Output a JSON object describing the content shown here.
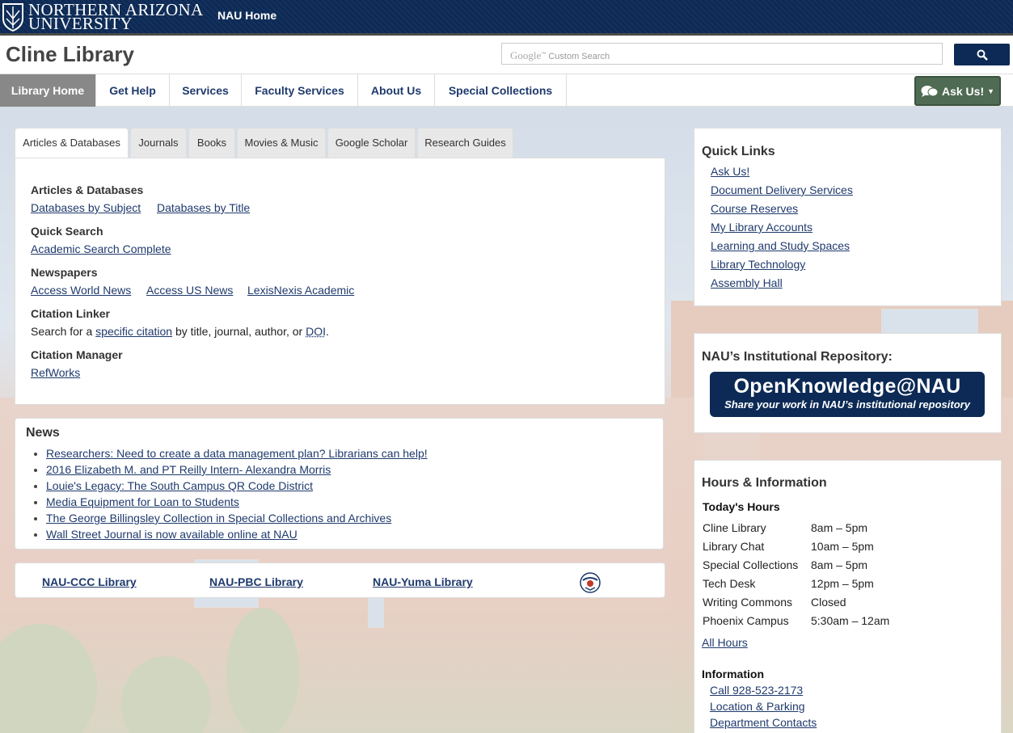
{
  "topbar": {
    "logo_line1": "NORTHERN ARIZONA",
    "logo_line2": "UNIVERSITY",
    "home_link": "NAU Home"
  },
  "header": {
    "site_title": "Cline Library",
    "search_brand": "Google",
    "search_placeholder": "Custom Search",
    "search_icon": "search-icon"
  },
  "nav": {
    "items": [
      "Library Home",
      "Get Help",
      "Services",
      "Faculty Services",
      "About Us",
      "Special Collections"
    ],
    "active": "Library Home",
    "ask_label": "Ask Us!"
  },
  "tabs": [
    "Articles & Databases",
    "Journals",
    "Books",
    "Movies & Music",
    "Google Scholar",
    "Research Guides"
  ],
  "articles": {
    "section1_title": "Articles & Databases",
    "section1_links": [
      "Databases by Subject",
      "Databases by Title"
    ],
    "section2_title": "Quick Search",
    "section2_links": [
      "Academic Search Complete"
    ],
    "section3_title": "Newspapers",
    "section3_links": [
      "Access World News",
      "Access US News",
      "LexisNexis Academic"
    ],
    "section4_title": "Citation Linker",
    "section4_text_pre": "Search for a",
    "section4_link": "specific citation",
    "section4_text_mid": "by title, journal, author, or",
    "section4_link2": "DOI",
    "section4_text_post": ".",
    "section5_title": "Citation Manager",
    "section5_links": [
      "RefWorks"
    ]
  },
  "news": {
    "title": "News",
    "items": [
      "Researchers: Need to create a data management plan? Librarians can help!",
      "2016 Elizabeth M. and PT Reilly Intern- Alexandra Morris",
      "Louie's Legacy: The South Campus QR Code District",
      "Media Equipment for Loan to Students",
      "The George Billingsley Collection in Special Collections and Archives",
      "Wall Street Journal is now available online at NAU"
    ]
  },
  "libraries": [
    "NAU-CCC Library",
    "NAU-PBC Library",
    "NAU-Yuma Library"
  ],
  "quick_links": {
    "title": "Quick Links",
    "items": [
      "Ask Us!",
      "Document Delivery Services",
      "Course Reserves",
      "My Library Accounts",
      "Learning and Study Spaces",
      "Library Technology",
      "Assembly Hall"
    ]
  },
  "repository": {
    "title": "NAU’s Institutional Repository:",
    "banner_main": "OpenKnowledge@NAU",
    "banner_sub": "Share your work in NAU’s institutional repository"
  },
  "hours": {
    "title": "Hours & Information",
    "todays_hours_label": "Today's Hours",
    "rows": [
      {
        "place": "Cline Library",
        "time": "8am – 5pm"
      },
      {
        "place": "Library Chat",
        "time": "10am – 5pm"
      },
      {
        "place": "Special Collections",
        "time": "8am – 5pm"
      },
      {
        "place": "Tech Desk",
        "time": "12pm – 5pm"
      },
      {
        "place": "Writing Commons",
        "time": "Closed"
      },
      {
        "place": "Phoenix Campus",
        "time": "5:30am – 12am"
      }
    ],
    "all_hours_link": "All Hours",
    "info_label": "Information",
    "info_links": [
      "Call 928-523-2173",
      "Location & Parking",
      "Department Contacts"
    ]
  },
  "colors": {
    "brand_navy": "#0c2a55",
    "link": "#1f3a6d",
    "ask_green": "#4f6b53"
  }
}
